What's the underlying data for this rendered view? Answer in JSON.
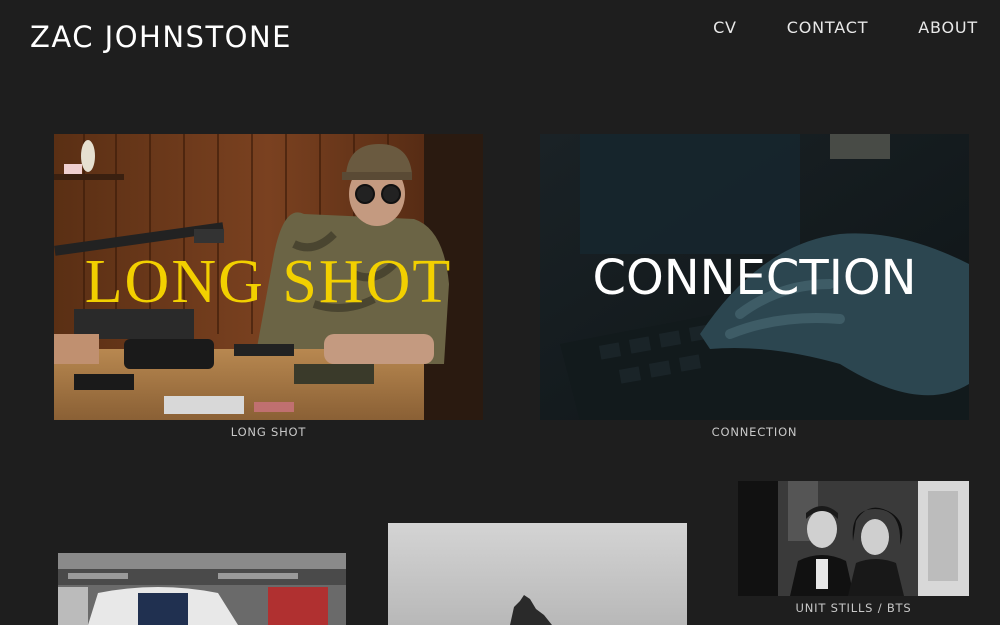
{
  "header": {
    "site_title": "ZAC JOHNSTONE",
    "nav": [
      {
        "label": "CV"
      },
      {
        "label": "CONTACT"
      },
      {
        "label": "ABOUT"
      }
    ]
  },
  "projects": [
    {
      "overlay_title": "LONG SHOT",
      "caption": "LONG SHOT",
      "overlay_color": "#f2d000"
    },
    {
      "overlay_title": "CONNECTION",
      "caption": "CONNECTION",
      "overlay_color": "#ffffff"
    },
    {
      "caption": "UNIT STILLS / BTS"
    }
  ],
  "colors": {
    "background": "#1e1e1e",
    "text": "#ffffff",
    "caption": "#c8c8c8",
    "accent_yellow": "#f2d000"
  }
}
